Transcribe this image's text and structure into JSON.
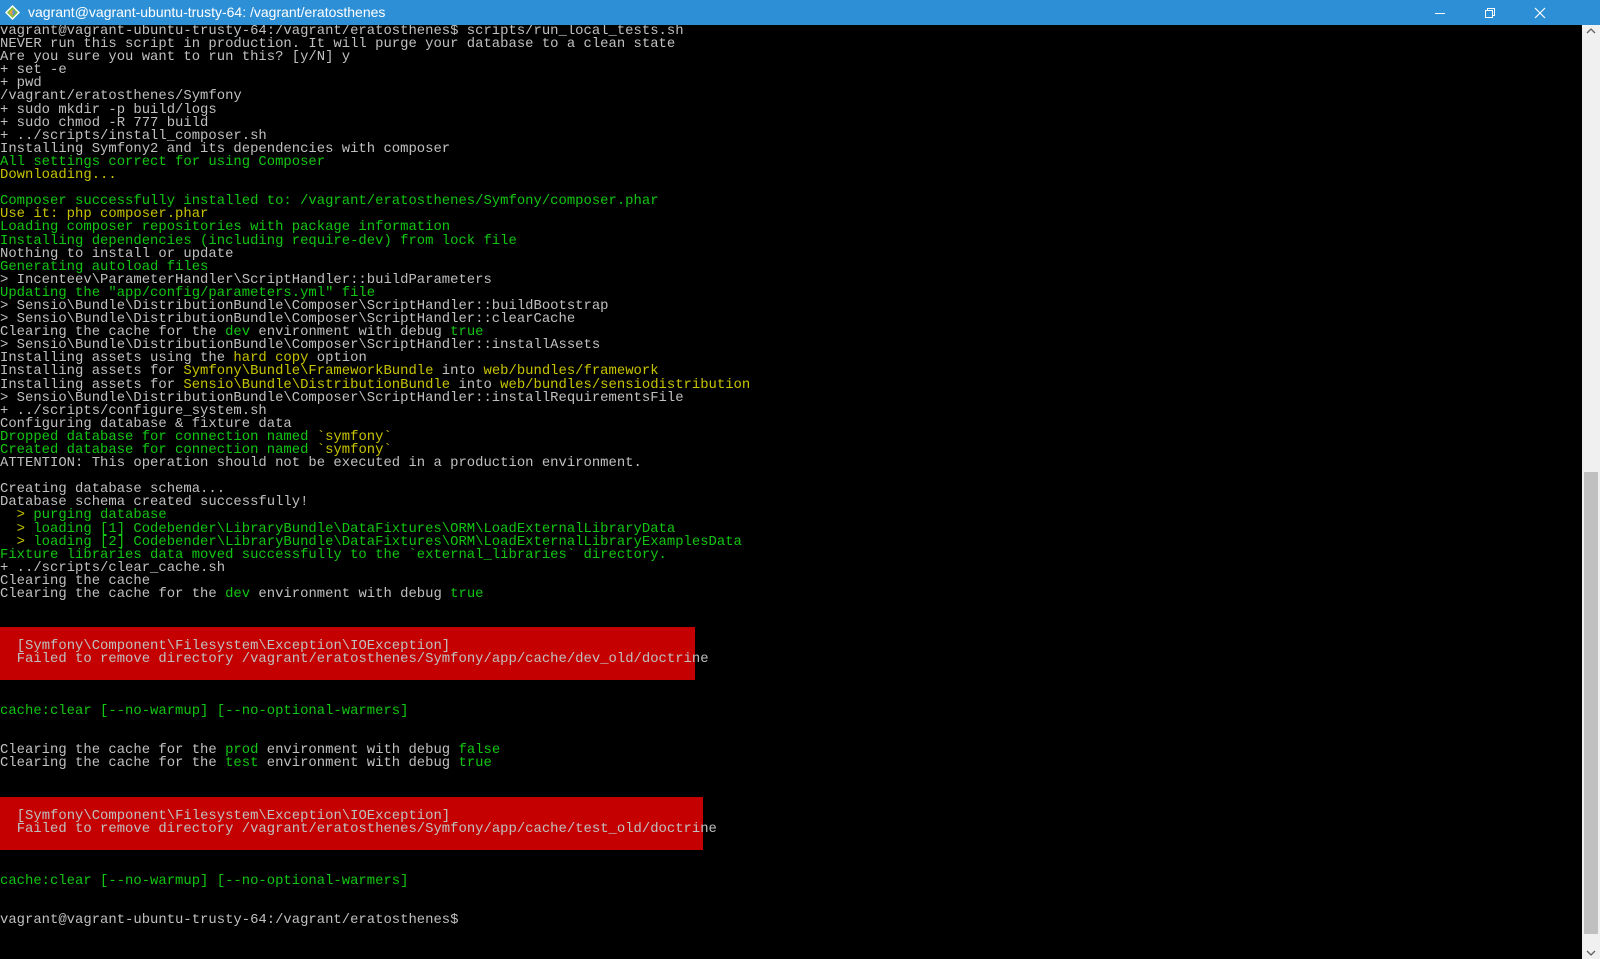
{
  "window": {
    "title": "vagrant@vagrant-ubuntu-trusty-64: /vagrant/eratosthenes",
    "colors": {
      "titlebar": "#2d8fd5",
      "terminal_bg": "#000000",
      "text": "#c0c0c0",
      "green": "#13c613",
      "yellow": "#c7c400",
      "error_bg": "#c50000"
    }
  },
  "terminal": {
    "lines": [
      [
        {
          "t": "vagrant@vagrant-ubuntu-trusty-64:/vagrant/eratosthenes$ scripts/run_local_tests.sh"
        }
      ],
      [
        {
          "t": "NEVER run this script in production. It will purge your database to a clean state"
        }
      ],
      [
        {
          "t": "Are you sure you want to run this? [y/N] y"
        }
      ],
      [
        {
          "t": "+ set -e"
        }
      ],
      [
        {
          "t": "+ pwd"
        }
      ],
      [
        {
          "t": "/vagrant/eratosthenes/Symfony"
        }
      ],
      [
        {
          "t": "+ sudo mkdir -p build/logs"
        }
      ],
      [
        {
          "t": "+ sudo chmod -R 777 build"
        }
      ],
      [
        {
          "t": "+ ../scripts/install_composer.sh"
        }
      ],
      [
        {
          "t": "Installing Symfony2 and its dependencies with composer"
        }
      ],
      [
        {
          "t": "All settings correct for using Composer",
          "c": "g"
        }
      ],
      [
        {
          "t": "Downloading...",
          "c": "y"
        }
      ],
      [
        {
          "t": ""
        }
      ],
      [
        {
          "t": "Composer successfully installed to: /vagrant/eratosthenes/Symfony/composer.phar",
          "c": "g"
        }
      ],
      [
        {
          "t": "Use it: php composer.phar",
          "c": "y"
        }
      ],
      [
        {
          "t": "Loading composer repositories with package information",
          "c": "g"
        }
      ],
      [
        {
          "t": "Installing dependencies (including require-dev) from lock file",
          "c": "g"
        }
      ],
      [
        {
          "t": "Nothing to install or update"
        }
      ],
      [
        {
          "t": "Generating autoload files",
          "c": "g"
        }
      ],
      [
        {
          "t": "> Incenteev\\ParameterHandler\\ScriptHandler::buildParameters"
        }
      ],
      [
        {
          "t": "Updating the \"app/config/parameters.yml\" file",
          "c": "g"
        }
      ],
      [
        {
          "t": "> Sensio\\Bundle\\DistributionBundle\\Composer\\ScriptHandler::buildBootstrap"
        }
      ],
      [
        {
          "t": "> Sensio\\Bundle\\DistributionBundle\\Composer\\ScriptHandler::clearCache"
        }
      ],
      [
        {
          "t": "Clearing the cache for the "
        },
        {
          "t": "dev",
          "c": "g"
        },
        {
          "t": " environment with debug "
        },
        {
          "t": "true",
          "c": "g"
        }
      ],
      [
        {
          "t": "> Sensio\\Bundle\\DistributionBundle\\Composer\\ScriptHandler::installAssets"
        }
      ],
      [
        {
          "t": "Installing assets using the "
        },
        {
          "t": "hard copy",
          "c": "y"
        },
        {
          "t": " option"
        }
      ],
      [
        {
          "t": "Installing assets for "
        },
        {
          "t": "Symfony\\Bundle\\FrameworkBundle",
          "c": "y"
        },
        {
          "t": " into "
        },
        {
          "t": "web/bundles/framework",
          "c": "y"
        }
      ],
      [
        {
          "t": "Installing assets for "
        },
        {
          "t": "Sensio\\Bundle\\DistributionBundle",
          "c": "y"
        },
        {
          "t": " into "
        },
        {
          "t": "web/bundles/sensiodistribution",
          "c": "y"
        }
      ],
      [
        {
          "t": "> Sensio\\Bundle\\DistributionBundle\\Composer\\ScriptHandler::installRequirementsFile"
        }
      ],
      [
        {
          "t": "+ ../scripts/configure_system.sh"
        }
      ],
      [
        {
          "t": "Configuring database & fixture data"
        }
      ],
      [
        {
          "t": "Dropped database for connection named ",
          "c": "g"
        },
        {
          "t": "`symfony`",
          "c": "y"
        }
      ],
      [
        {
          "t": "Created database for connection named ",
          "c": "g"
        },
        {
          "t": "`symfony`",
          "c": "y"
        }
      ],
      [
        {
          "t": "ATTENTION: This operation should not be executed in a production environment."
        }
      ],
      [
        {
          "t": ""
        }
      ],
      [
        {
          "t": "Creating database schema..."
        }
      ],
      [
        {
          "t": "Database schema created successfully!"
        }
      ],
      [
        {
          "t": "  > ",
          "c": "y"
        },
        {
          "t": "purging database",
          "c": "g"
        }
      ],
      [
        {
          "t": "  > ",
          "c": "y"
        },
        {
          "t": "loading [1] Codebender\\LibraryBundle\\DataFixtures\\ORM\\LoadExternalLibraryData",
          "c": "g"
        }
      ],
      [
        {
          "t": "  > ",
          "c": "y"
        },
        {
          "t": "loading [2] Codebender\\LibraryBundle\\DataFixtures\\ORM\\LoadExternalLibraryExamplesData",
          "c": "g"
        }
      ],
      [
        {
          "t": "Fixture libraries data moved successfully to the `external_libraries` directory.",
          "c": "g"
        }
      ],
      [
        {
          "t": "+ ../scripts/clear_cache.sh"
        }
      ],
      [
        {
          "t": "Clearing the cache"
        }
      ],
      [
        {
          "t": "Clearing the cache for the "
        },
        {
          "t": "dev",
          "c": "g"
        },
        {
          "t": " environment with debug "
        },
        {
          "t": "true",
          "c": "g"
        }
      ]
    ],
    "error1": {
      "line1": "[Symfony\\Component\\Filesystem\\Exception\\IOException]",
      "line2": "Failed to remove directory /vagrant/eratosthenes/Symfony/app/cache/dev_old/doctrine"
    },
    "usage1": "cache:clear [--no-warmup] [--no-optional-warmers]",
    "prod_line": [
      {
        "t": "Clearing the cache for the "
      },
      {
        "t": "prod",
        "c": "g"
      },
      {
        "t": " environment with debug "
      },
      {
        "t": "false",
        "c": "g"
      }
    ],
    "test_line": [
      {
        "t": "Clearing the cache for the "
      },
      {
        "t": "test",
        "c": "g"
      },
      {
        "t": " environment with debug "
      },
      {
        "t": "true",
        "c": "g"
      }
    ],
    "error2": {
      "line1": "[Symfony\\Component\\Filesystem\\Exception\\IOException]",
      "line2": "Failed to remove directory /vagrant/eratosthenes/Symfony/app/cache/test_old/doctrine"
    },
    "usage2": "cache:clear [--no-warmup] [--no-optional-warmers]",
    "prompt": "vagrant@vagrant-ubuntu-trusty-64:/vagrant/eratosthenes$"
  }
}
